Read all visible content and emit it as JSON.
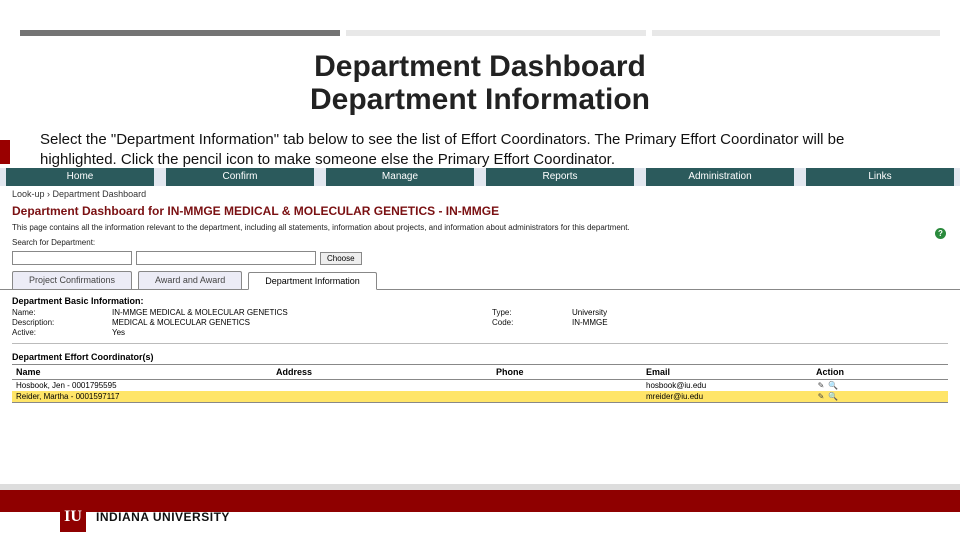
{
  "slide": {
    "title_line1": "Department Dashboard",
    "title_line2": "Department Information",
    "instructions": "Select the \"Department Information\" tab below to see the list of Effort Coordinators. The Primary Effort Coordinator will be highlighted. Click the pencil icon to make someone else the Primary Effort Coordinator."
  },
  "nav": {
    "items": [
      "Home",
      "Confirm",
      "Manage",
      "Reports",
      "Administration",
      "Links"
    ]
  },
  "breadcrumb": {
    "item0": "Look-up",
    "sep": " › ",
    "item1": "Department Dashboard"
  },
  "dashboard": {
    "title": "Department Dashboard for IN-MMGE MEDICAL & MOLECULAR GENETICS - IN-MMGE",
    "description": "This page contains all the information relevant to the department, including all statements, information about projects, and information about administrators for this department.",
    "search_label": "Search for Department:",
    "choose_label": "Choose"
  },
  "tabs": {
    "t0": "Project Confirmations",
    "t1": "Award and Award",
    "t2": "Department Information"
  },
  "sections": {
    "basic_label": "Department Basic Information:",
    "ec_label": "Department Effort Coordinator(s)"
  },
  "basic": {
    "name_label": "Name:",
    "name_value": "IN-MMGE MEDICAL & MOLECULAR GENETICS",
    "desc_label": "Description:",
    "desc_value": "MEDICAL & MOLECULAR GENETICS",
    "active_label": "Active:",
    "active_value": "Yes",
    "type_label": "Type:",
    "type_value": "University",
    "code_label": "Code:",
    "code_value": "IN-MMGE"
  },
  "coord": {
    "headers": {
      "name": "Name",
      "address": "Address",
      "phone": "Phone",
      "email": "Email",
      "action": "Action"
    },
    "rows": [
      {
        "name": "Hosbook, Jen - 0001795595",
        "address": "",
        "phone": "",
        "email": "hosbook@iu.edu",
        "highlight": false
      },
      {
        "name": "Reider, Martha - 0001597117",
        "address": "",
        "phone": "",
        "email": "mreider@iu.edu",
        "highlight": true
      }
    ]
  },
  "footer": {
    "org": "INDIANA UNIVERSITY",
    "logo_text": "IU"
  }
}
